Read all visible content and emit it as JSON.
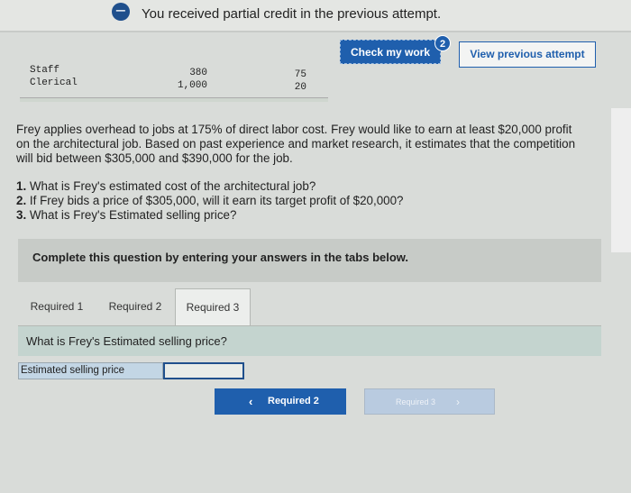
{
  "banner": {
    "text": "You received partial credit in the previous attempt."
  },
  "header": {
    "check_label": "Check my work",
    "check_badge": "2",
    "view_label": "View previous attempt"
  },
  "table": {
    "labels": [
      "Staff",
      "Clerical"
    ],
    "col1": [
      "380",
      "1,000"
    ],
    "col2": [
      "75",
      "20"
    ]
  },
  "problem": {
    "paragraph": "Frey applies overhead to jobs at 175% of direct labor cost. Frey would like to earn at least $20,000 profit on the architectural job. Based on past experience and market research, it estimates that the competition will bid between $305,000 and $390,000 for the job.",
    "questions": [
      {
        "num": "1.",
        "text": "What is Frey's estimated cost of the architectural job?"
      },
      {
        "num": "2.",
        "text": "If Frey bids a price of $305,000, will it earn its target profit of $20,000?"
      },
      {
        "num": "3.",
        "text": "What is Frey's Estimated selling price?"
      }
    ]
  },
  "instruction": "Complete this question by entering your answers in the tabs below.",
  "tabs": [
    "Required 1",
    "Required 2",
    "Required 3"
  ],
  "active_question": "What is Frey's Estimated selling price?",
  "answer": {
    "label": "Estimated selling price",
    "value": ""
  },
  "nav": {
    "prev_label": "Required 2",
    "next_label": "Required 3"
  }
}
